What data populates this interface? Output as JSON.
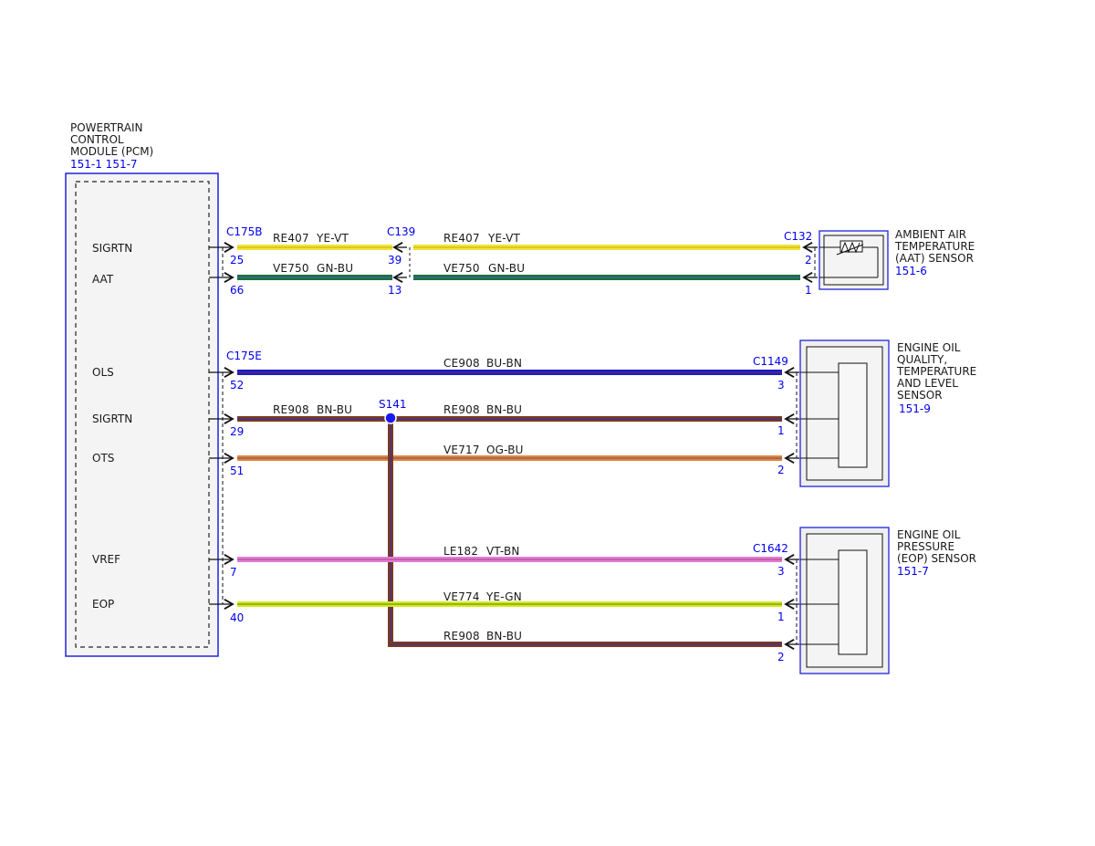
{
  "pcm": {
    "name_lines": [
      "POWERTRAIN",
      "CONTROL",
      "MODULE (PCM)"
    ],
    "refs": "151-1 151-7",
    "pins": [
      "SIGRTN",
      "AAT",
      "OLS",
      "SIGRTN",
      "OTS",
      "VREF",
      "EOP"
    ]
  },
  "connectors": {
    "c175b": "C175B",
    "c175e": "C175E",
    "c139": "C139",
    "c132": "C132",
    "c1149": "C1149",
    "c1642": "C1642",
    "s141": "S141"
  },
  "pin_numbers": {
    "pcm": [
      "25",
      "66",
      "52",
      "29",
      "51",
      "7",
      "40"
    ],
    "c139": [
      "39",
      "13"
    ],
    "aat": [
      "2",
      "1"
    ],
    "eoq": [
      "3",
      "1",
      "2"
    ],
    "eop": [
      "3",
      "1",
      "2"
    ]
  },
  "wires": {
    "w1a": {
      "circuit": "RE407",
      "color": "YE-VT"
    },
    "w1b": {
      "circuit": "RE407",
      "color": "YE-VT"
    },
    "w2a": {
      "circuit": "VE750",
      "color": "GN-BU"
    },
    "w2b": {
      "circuit": "VE750",
      "color": "GN-BU"
    },
    "w3": {
      "circuit": "CE908",
      "color": "BU-BN"
    },
    "w4a": {
      "circuit": "RE908",
      "color": "BN-BU"
    },
    "w4b": {
      "circuit": "RE908",
      "color": "BN-BU"
    },
    "w5": {
      "circuit": "VE717",
      "color": "OG-BU"
    },
    "w6": {
      "circuit": "LE182",
      "color": "VT-BN"
    },
    "w7": {
      "circuit": "VE774",
      "color": "YE-GN"
    },
    "w8": {
      "circuit": "RE908",
      "color": "BN-BU"
    }
  },
  "components": {
    "aat": {
      "lines": [
        "AMBIENT AIR",
        "TEMPERATURE",
        "(AAT) SENSOR"
      ],
      "ref": "151-6"
    },
    "eoq": {
      "lines": [
        "ENGINE OIL",
        "QUALITY,",
        "TEMPERATURE",
        "AND LEVEL",
        "SENSOR"
      ],
      "ref": "151-9"
    },
    "eop": {
      "lines": [
        "ENGINE OIL",
        "PRESSURE",
        "(EOP) SENSOR"
      ],
      "ref": "151-7"
    }
  },
  "palette": {
    "yellow": "#f2e23a",
    "violet": "#c050c0",
    "green": "#1e6e3c",
    "blue": "#1a1ad0",
    "brown": "#7a3b1e",
    "orange": "#e8852a",
    "pink": "#e57ad8",
    "yellow_green": "#d8e81a",
    "connector_blue": "#0000ee",
    "pcm_fill": "#f2f2f2",
    "sensor_fill": "#efefef"
  }
}
